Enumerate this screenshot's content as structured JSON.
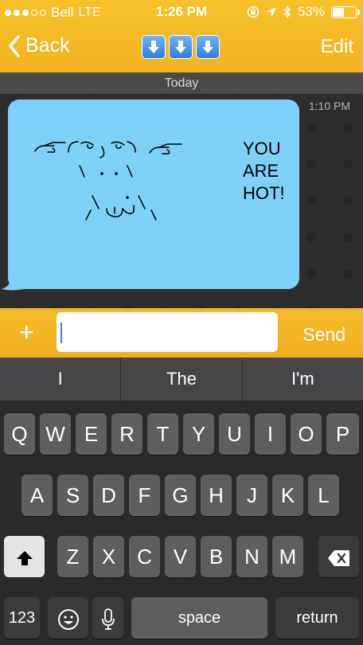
{
  "status": {
    "carrier": "Bell",
    "network": "LTE",
    "time": "1:26 PM",
    "battery": "53%",
    "battery_level": 0.53
  },
  "nav": {
    "back_label": "Back",
    "edit_label": "Edit",
    "title_icons": [
      "down-arrow-icon",
      "down-arrow-icon",
      "down-arrow-icon"
    ]
  },
  "chat": {
    "day_label": "Today",
    "message": {
      "time": "1:10 PM",
      "text_lines": [
        "YOU",
        "ARE",
        "HOT!"
      ]
    }
  },
  "composer": {
    "plus_label": "+",
    "input_value": "",
    "send_label": "Send"
  },
  "predictive": [
    "I",
    "The",
    "I'm"
  ],
  "keyboard": {
    "row1": [
      "Q",
      "W",
      "E",
      "R",
      "T",
      "Y",
      "U",
      "I",
      "O",
      "P"
    ],
    "row2": [
      "A",
      "S",
      "D",
      "F",
      "G",
      "H",
      "J",
      "K",
      "L"
    ],
    "row3": [
      "Z",
      "X",
      "C",
      "V",
      "B",
      "N",
      "M"
    ],
    "numbers_label": "123",
    "space_label": "space",
    "return_label": "return"
  },
  "colors": {
    "brand": "#f5b823",
    "bubble": "#7fd0f8",
    "caret": "#3a7cf5"
  }
}
